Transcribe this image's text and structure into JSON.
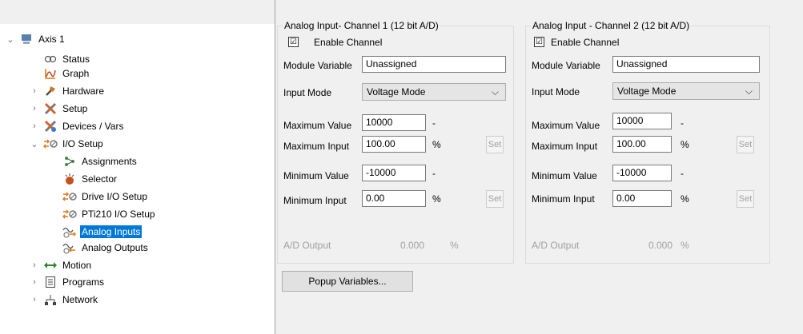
{
  "tree": {
    "items": [
      {
        "label": "Axis 1",
        "chevron": "⌄",
        "icon": "axis-icon"
      },
      {
        "label": "Status",
        "icon": "status-icon"
      },
      {
        "label": "Graph",
        "icon": "graph-icon"
      },
      {
        "label": "Hardware",
        "chevron": "›",
        "icon": "hardware-icon"
      },
      {
        "label": "Setup",
        "chevron": "›",
        "icon": "setup-icon"
      },
      {
        "label": "Devices / Vars",
        "chevron": "›",
        "icon": "devices-icon"
      },
      {
        "label": "I/O Setup",
        "chevron": "⌄",
        "icon": "io-setup-icon"
      },
      {
        "label": "Assignments",
        "icon": "assignments-icon"
      },
      {
        "label": "Selector",
        "icon": "selector-icon"
      },
      {
        "label": "Drive I/O Setup",
        "icon": "drive-io-icon"
      },
      {
        "label": "PTi210 I/O Setup",
        "icon": "pti210-io-icon"
      },
      {
        "label": "Analog Inputs",
        "icon": "analog-inputs-icon"
      },
      {
        "label": "Analog Outputs",
        "icon": "analog-outputs-icon"
      },
      {
        "label": "Motion",
        "chevron": "›",
        "icon": "motion-icon"
      },
      {
        "label": "Programs",
        "chevron": "›",
        "icon": "programs-icon"
      },
      {
        "label": "Network",
        "chevron": "›",
        "icon": "network-icon"
      }
    ]
  },
  "ch1": {
    "title": "Analog Input- Channel 1 (12 bit A/D)",
    "enable_label": "Enable Channel",
    "checkmark": "☑",
    "module_variable_label": "Module Variable",
    "module_variable_value": "Unassigned",
    "input_mode_label": "Input Mode",
    "input_mode_value": "Voltage Mode",
    "max_value_label": "Maximum Value",
    "max_value": "10000",
    "max_value_unit": "-",
    "max_input_label": "Maximum Input",
    "max_input": "100.00",
    "max_input_unit": "%",
    "min_value_label": "Minimum Value",
    "min_value": "-10000",
    "min_value_unit": "-",
    "min_input_label": "Minimum Input",
    "min_input": "0.00",
    "min_input_unit": "%",
    "set_label": "Set",
    "ad_output_label": "A/D Output",
    "ad_output_value": "0.000",
    "ad_output_unit": "%"
  },
  "ch2": {
    "title": "Analog Input - Channel 2 (12 bit A/D)",
    "enable_label": "Enable Channel",
    "checkmark": "☑",
    "module_variable_label": "Module Variable",
    "module_variable_value": "Unassigned",
    "input_mode_label": "Input Mode",
    "input_mode_value": "Voltage Mode",
    "max_value_label": "Maximum Value",
    "max_value": "10000",
    "max_value_unit": "-",
    "max_input_label": "Maximum Input",
    "max_input": "100.00",
    "max_input_unit": "%",
    "min_value_label": "Minimum Value",
    "min_value": "-10000",
    "min_value_unit": "-",
    "min_input_label": "Minimum Input",
    "min_input": "0.00",
    "min_input_unit": "%",
    "set_label": "Set",
    "ad_output_label": "A/D Output",
    "ad_output_value": "0.000",
    "ad_output_unit": "%"
  },
  "popup_label": "Popup Variables...",
  "colors": {
    "selection": "#0078d7",
    "disabled_text": "#a0a0a0"
  }
}
